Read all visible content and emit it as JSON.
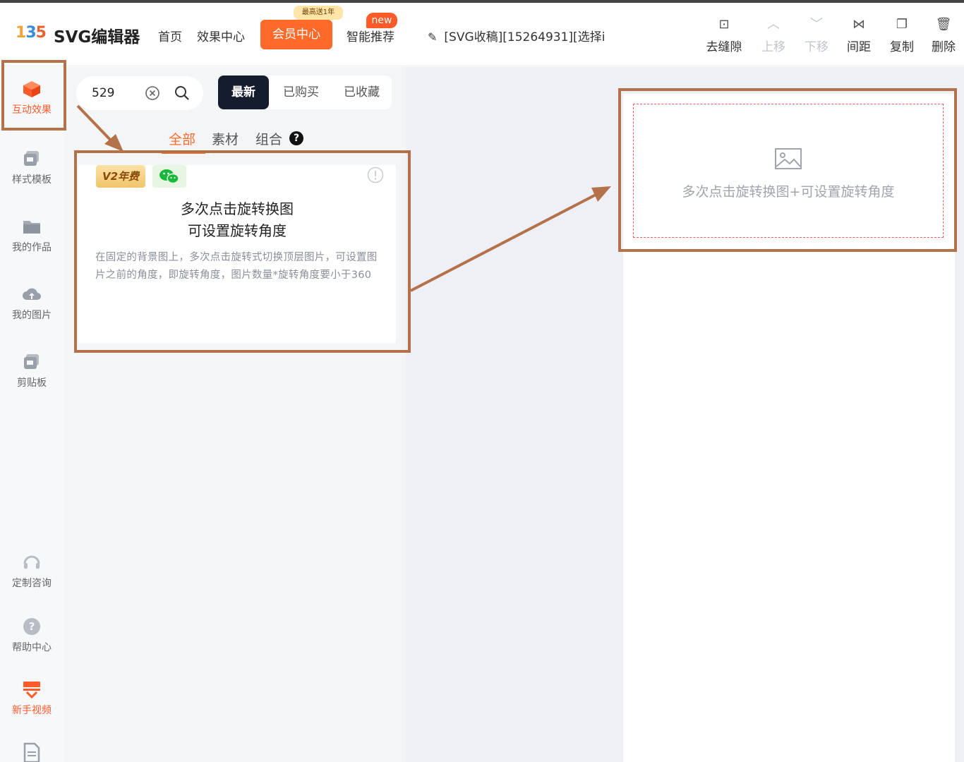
{
  "header": {
    "logo_text": "135",
    "brand": "SVG编辑器",
    "nav": [
      {
        "label": "首页"
      },
      {
        "label": "效果中心"
      },
      {
        "label": "会员中心"
      },
      {
        "label": "智能推荐"
      }
    ],
    "vip_promo_tag": "最高送1年",
    "new_tag": "new",
    "doc_title": "[SVG收稿][15264931][选择i",
    "tools": [
      {
        "label": "去缝隙",
        "icon": "gap-icon",
        "disabled": false
      },
      {
        "label": "上移",
        "icon": "chevron-up-icon",
        "disabled": true
      },
      {
        "label": "下移",
        "icon": "chevron-down-icon",
        "disabled": true
      },
      {
        "label": "间距",
        "icon": "spacing-icon",
        "disabled": false
      },
      {
        "label": "复制",
        "icon": "copy-icon",
        "disabled": false
      },
      {
        "label": "删除",
        "icon": "trash-icon",
        "disabled": false
      }
    ]
  },
  "sidebar": {
    "items": [
      {
        "label": "互动效果",
        "icon": "cube-icon",
        "active": true
      },
      {
        "label": "样式模板",
        "icon": "template-icon",
        "active": false
      },
      {
        "label": "我的作品",
        "icon": "folder-icon",
        "active": false
      },
      {
        "label": "我的图片",
        "icon": "cloud-icon",
        "active": false
      },
      {
        "label": "剪贴板",
        "icon": "clipboard-icon",
        "active": false
      },
      {
        "label": "定制咨询",
        "icon": "headset-icon",
        "active": false
      },
      {
        "label": "帮助中心",
        "icon": "help-icon",
        "active": false
      },
      {
        "label": "新手视频",
        "icon": "video-icon",
        "active": true
      }
    ]
  },
  "panel": {
    "search_value": "529",
    "segments": [
      {
        "label": "最新",
        "active": true
      },
      {
        "label": "已购买",
        "active": false
      },
      {
        "label": "已收藏",
        "active": false
      }
    ],
    "subtabs": [
      {
        "label": "全部",
        "active": true
      },
      {
        "label": "素材",
        "active": false
      },
      {
        "label": "组合",
        "active": false
      }
    ],
    "help_mark": "?",
    "card": {
      "badge": "V2年费",
      "title_line1": "多次点击旋转换图",
      "title_line2": "可设置旋转角度",
      "description": "在固定的背景图上，多次点击旋转式切换顶层图片，可设置图片之前的角度，即旋转角度，图片数量*旋转角度要小于360"
    }
  },
  "canvas": {
    "placeholder_text": "多次点击旋转换图+可设置旋转角度"
  },
  "colors": {
    "accent": "#ff6a2a",
    "annotation": "#b3724a",
    "dark_segment": "#151c2e"
  }
}
